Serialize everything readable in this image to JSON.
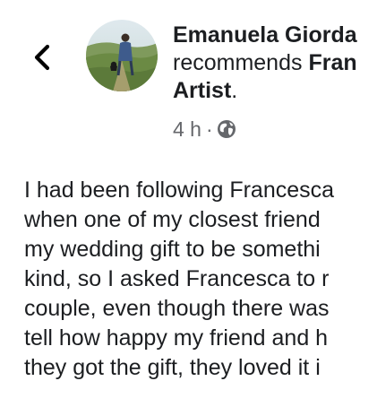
{
  "header": {
    "back_icon": "chevron-left-icon",
    "avatar_icon": "profile-photo",
    "author_name": "Emanuela Giorda",
    "action_text": "recommends ",
    "page_name_part1": "Fran",
    "page_name_part2": "Artist",
    "period": "."
  },
  "meta": {
    "time": "4 h",
    "separator": "·",
    "privacy_icon": "globe-icon"
  },
  "post": {
    "lines": [
      "I had been following Francesca",
      "when one of my closest friend",
      "my wedding gift to be somethi",
      "kind, so I asked Francesca to r",
      "couple, even though there was",
      "tell how happy my friend and h",
      "they got the gift, they loved it i"
    ]
  },
  "colors": {
    "text": "#1c1e21",
    "meta": "#65676b",
    "background": "#ffffff"
  }
}
